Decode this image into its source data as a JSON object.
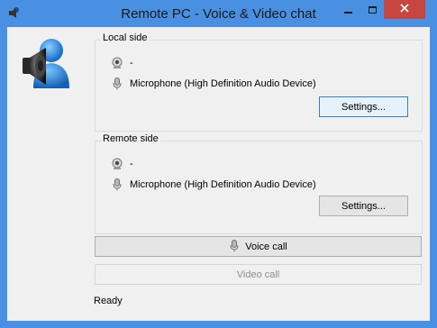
{
  "window": {
    "title": "Remote PC - Voice & Video chat",
    "accent_color": "#4a90e2",
    "close_color": "#c7463f"
  },
  "local_side": {
    "title": "Local side",
    "webcam_label": "-",
    "microphone_label": "Microphone (High Definition Audio Device)",
    "settings_label": "Settings..."
  },
  "remote_side": {
    "title": "Remote side",
    "webcam_label": "-",
    "microphone_label": "Microphone (High Definition Audio Device)",
    "settings_label": "Settings..."
  },
  "actions": {
    "voice_call_label": "Voice call",
    "video_call_label": "Video call"
  },
  "status": {
    "text": "Ready"
  },
  "icons": {
    "app": "speaker-user-icon",
    "webcam": "webcam-icon",
    "microphone": "microphone-icon",
    "close": "close-icon",
    "minimize": "minimize-icon",
    "maximize": "maximize-icon"
  }
}
